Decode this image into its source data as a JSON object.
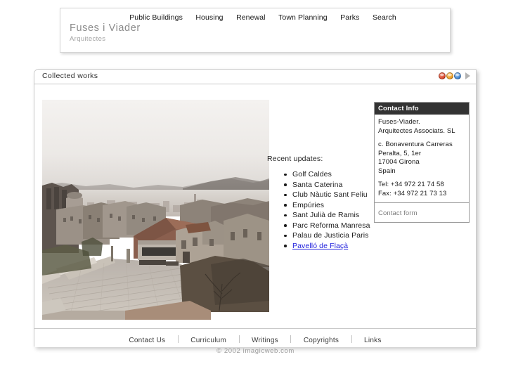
{
  "header": {
    "brand_name": "Fuses i Viader",
    "brand_sub": "Arquitectes",
    "nav": [
      {
        "label": "Public Buildings"
      },
      {
        "label": "Housing"
      },
      {
        "label": "Renewal"
      },
      {
        "label": "Town Planning"
      },
      {
        "label": "Parks"
      },
      {
        "label": "Search"
      }
    ]
  },
  "window": {
    "title": "Collected works",
    "controls": {
      "close_icon": "close-circle-icon",
      "minimize_icon": "minimize-circle-icon",
      "maximize_icon": "maximize-circle-icon",
      "expand_icon": "play-triangle-icon"
    },
    "colors": {
      "close": "#d9452a",
      "minimize": "#eb9b20",
      "maximize": "#3f82cd",
      "arrow": "#b3b3b3",
      "contact_header_bg": "#333333",
      "link": "#2222dd"
    }
  },
  "photo": {
    "alt": "Aerial photograph of a stone hill town plaza with paved square and distant city skyline"
  },
  "updates": {
    "title": "Recent updates:",
    "items": [
      {
        "label": "Golf Caldes",
        "link": false
      },
      {
        "label": "Santa Caterina",
        "link": false
      },
      {
        "label": "Club Nàutic Sant Feliu",
        "link": false
      },
      {
        "label": "Empúries",
        "link": false
      },
      {
        "label": "Sant Julià de Ramis",
        "link": false
      },
      {
        "label": "Parc Reforma Manresa",
        "link": false
      },
      {
        "label": "Palau de Justicia Paris",
        "link": false
      },
      {
        "label": "Pavelló de Flaçà",
        "link": true
      }
    ]
  },
  "contact": {
    "heading": "Contact Info",
    "lines_company": [
      "Fuses-Viader.",
      "Arquitectes Associats. SL"
    ],
    "lines_address": [
      "c. Bonaventura Carreras",
      "Peralta, 5, 1er",
      "17004 Girona",
      "Spain"
    ],
    "lines_phone": [
      "Tel: +34 972 21 74 58",
      "Fax: +34 972 21 73 13"
    ],
    "form_link": "Contact form"
  },
  "footer": {
    "nav": [
      {
        "label": "Contact Us"
      },
      {
        "label": "Curriculum"
      },
      {
        "label": "Writings"
      },
      {
        "label": "Copyrights"
      },
      {
        "label": "Links"
      }
    ],
    "copyright": "© 2002 imagicweb.com"
  }
}
